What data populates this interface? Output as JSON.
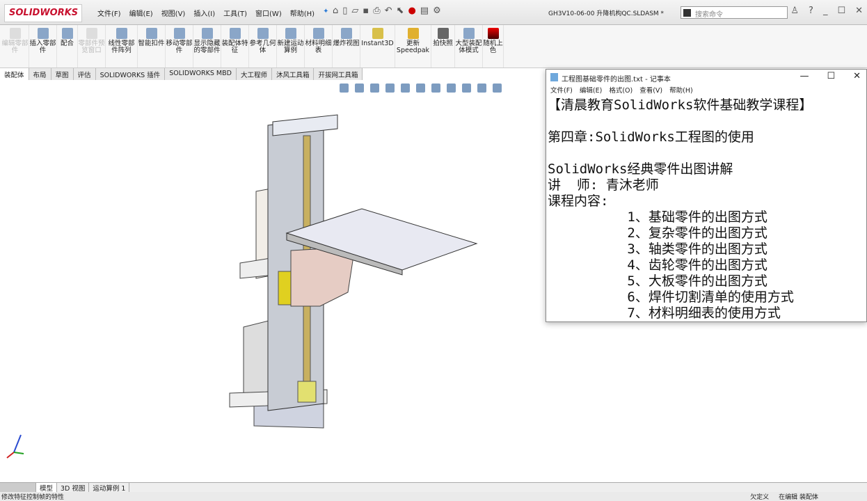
{
  "app": {
    "logo": "SOLIDWORKS",
    "document_title": "GH3V10-06-00 升降机构QC.SLDASM *",
    "search_placeholder": "搜索命令"
  },
  "menu": [
    "文件(F)",
    "编辑(E)",
    "视图(V)",
    "插入(I)",
    "工具(T)",
    "窗口(W)",
    "帮助(H)"
  ],
  "ribbon": [
    {
      "label": "编辑零部件",
      "enabled": false
    },
    {
      "label": "插入零部件",
      "enabled": true
    },
    {
      "label": "配合",
      "enabled": true
    },
    {
      "label": "零部件预览窗口",
      "enabled": false
    },
    {
      "label": "线性零部件阵列",
      "enabled": true
    },
    {
      "label": "智能扣件",
      "enabled": true
    },
    {
      "label": "移动零部件",
      "enabled": true
    },
    {
      "label": "显示隐藏的零部件",
      "enabled": true
    },
    {
      "label": "装配体特征",
      "enabled": true
    },
    {
      "label": "参考几何体",
      "enabled": true
    },
    {
      "label": "新建运动算例",
      "enabled": true
    },
    {
      "label": "材料明细表",
      "enabled": true
    },
    {
      "label": "爆炸视图",
      "enabled": true
    },
    {
      "label": "Instant3D",
      "enabled": true
    },
    {
      "label": "更新Speedpak",
      "enabled": true
    },
    {
      "label": "拍快照",
      "enabled": true
    },
    {
      "label": "大型装配体模式",
      "enabled": true
    },
    {
      "label": "随机上色",
      "enabled": true
    }
  ],
  "tabs": [
    "装配体",
    "布局",
    "草图",
    "评估",
    "SOLIDWORKS 插件",
    "SOLIDWORKS MBD",
    "大工程师",
    "沐风工具箱",
    "开拔网工具箱"
  ],
  "notepad": {
    "title": "工程图基础零件的出图.txt - 记事本",
    "menu": [
      "文件(F)",
      "编辑(E)",
      "格式(O)",
      "查看(V)",
      "帮助(H)"
    ],
    "lines": [
      "【清晨教育SolidWorks软件基础教学课程】",
      "",
      "第四章:SolidWorks工程图的使用",
      "",
      "SolidWorks经典零件出图讲解",
      "讲  师: 青沐老师",
      "课程内容:",
      "          1、基础零件的出图方式",
      "          2、复杂零件的出图方式",
      "          3、轴类零件的出图方式",
      "          4、齿轮零件的出图方式",
      "          5、大板零件的出图方式",
      "          6、焊件切割清单的使用方式",
      "          7、材料明细表的使用方式"
    ]
  },
  "bottom_tabs": [
    "模型",
    "3D 视图",
    "运动算例 1"
  ],
  "status": {
    "message": "修改特征控制帧的特性",
    "state": "欠定义",
    "mode": "在编辑 装配体"
  }
}
